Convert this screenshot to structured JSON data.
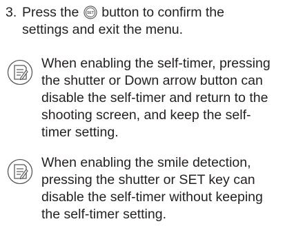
{
  "step": {
    "number": "3.",
    "line1_before_icon": "Press the",
    "icon": "set-button-icon",
    "icon_label": "SET",
    "line1_after_icon": "button to confirm the",
    "line2": "settings and exit the menu."
  },
  "notes": [
    {
      "icon": "note-icon",
      "lines": [
        "When enabling the self-timer, pressing",
        "the shutter or Down arrow button can",
        "disable the self-timer and return to the",
        "shooting screen, and keep the self-",
        "timer setting."
      ]
    },
    {
      "icon": "note-icon",
      "lines": [
        "When enabling the smile detection,",
        "pressing the shutter or SET key can",
        "disable the self-timer without keeping",
        "the self-timer setting."
      ]
    }
  ],
  "colors": {
    "text": "#231f20",
    "icon_stroke": "#58595b"
  }
}
